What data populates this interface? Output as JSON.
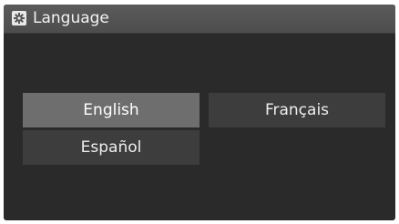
{
  "header": {
    "title": "Language",
    "icon": "gear-icon"
  },
  "languages": [
    {
      "label": "English",
      "selected": true
    },
    {
      "label": "Français",
      "selected": false
    },
    {
      "label": "Español",
      "selected": false
    }
  ],
  "colors": {
    "background": "#2a2a2a",
    "titlebar": "#555555",
    "button": "#3d3d3d",
    "button_selected": "#6e6e6e",
    "text": "#eeeeee"
  }
}
